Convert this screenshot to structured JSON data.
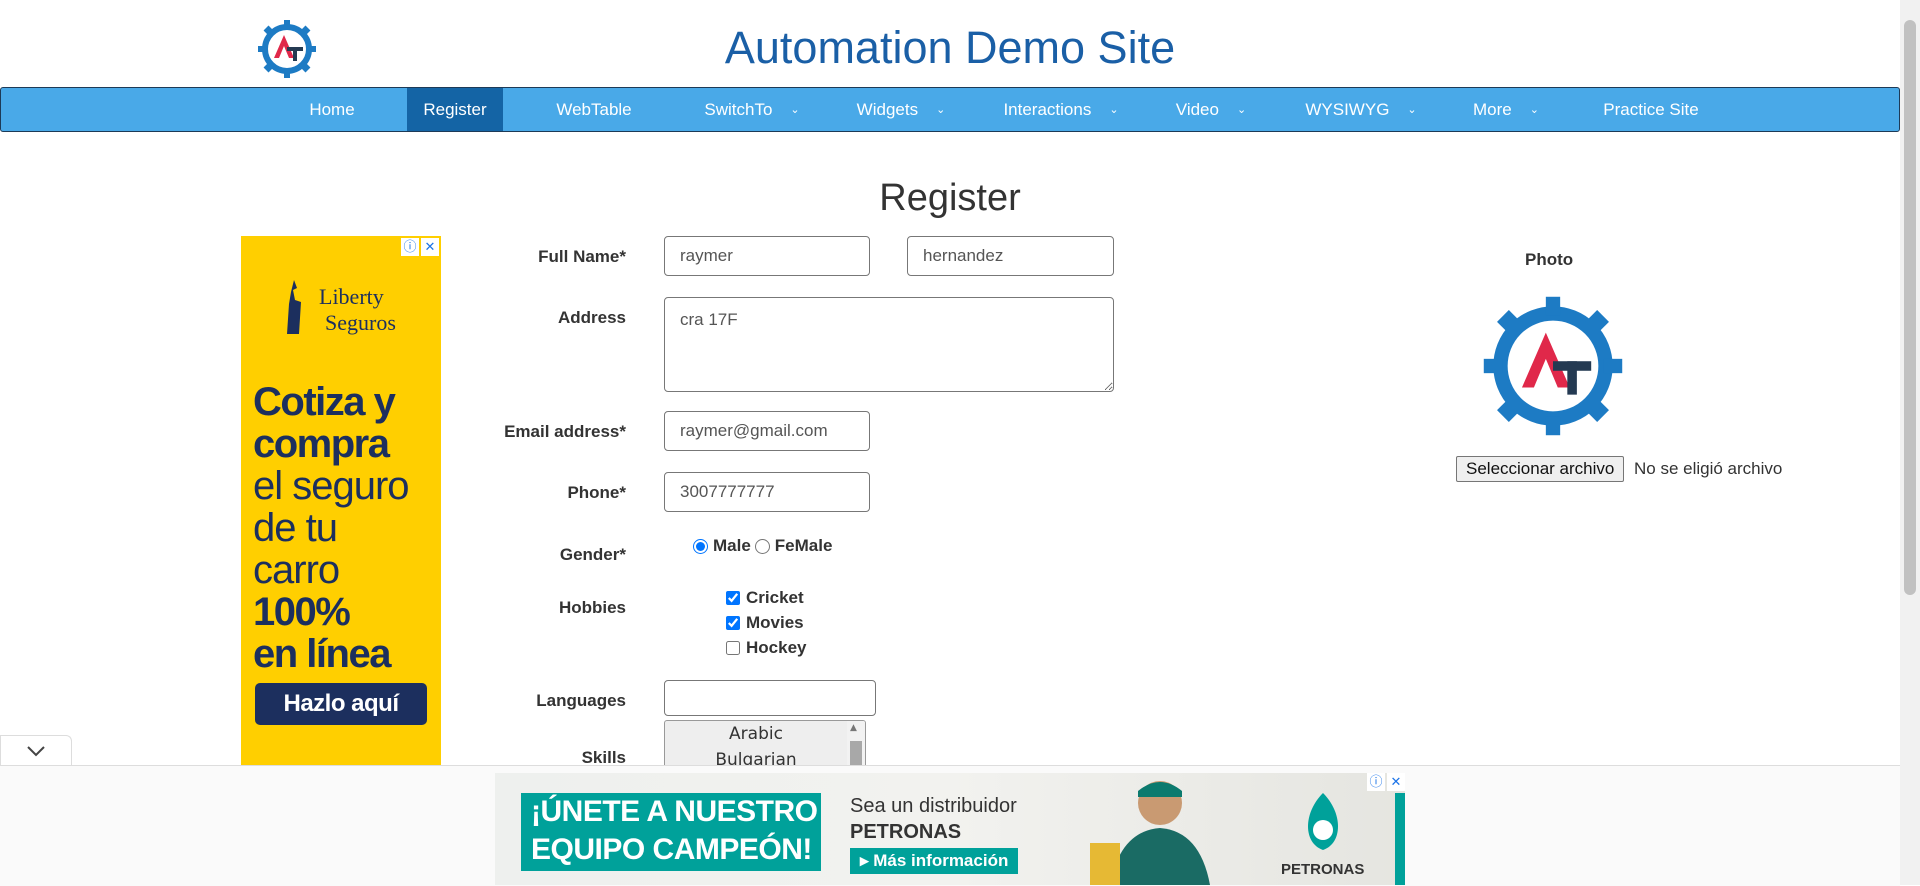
{
  "header": {
    "title": "Automation Demo Site"
  },
  "nav": {
    "items": [
      {
        "label": "Home"
      },
      {
        "label": "Register"
      },
      {
        "label": "WebTable"
      },
      {
        "label": "SwitchTo",
        "dropdown": true
      },
      {
        "label": "Widgets",
        "dropdown": true
      },
      {
        "label": "Interactions",
        "dropdown": true
      },
      {
        "label": "Video",
        "dropdown": true
      },
      {
        "label": "WYSIWYG",
        "dropdown": true
      },
      {
        "label": "More",
        "dropdown": true
      },
      {
        "label": "Practice Site"
      }
    ],
    "active": "Register"
  },
  "page": {
    "title": "Register"
  },
  "form": {
    "full_name_label": "Full Name*",
    "first_name": "raymer",
    "last_name": "hernandez",
    "address_label": "Address",
    "address": "cra 17F",
    "email_label": "Email address*",
    "email": "raymer@gmail.com",
    "phone_label": "Phone*",
    "phone": "3007777777",
    "gender_label": "Gender*",
    "gender_options": [
      "Male",
      "FeMale"
    ],
    "gender_selected": "Male",
    "hobbies_label": "Hobbies",
    "hobbies": [
      {
        "label": "Cricket",
        "checked": true
      },
      {
        "label": "Movies",
        "checked": true
      },
      {
        "label": "Hockey",
        "checked": false
      }
    ],
    "languages_label": "Languages",
    "languages_value": "",
    "skills_label": "Skills",
    "skills_options": [
      "Arabic",
      "Bulgarian"
    ]
  },
  "photo": {
    "label": "Photo",
    "button_label": "Seleccionar archivo",
    "status": "No se eligió archivo"
  },
  "ads": {
    "left": {
      "brand": "Liberty Seguros",
      "brand_line1": "Liberty",
      "brand_line2": "Seguros",
      "headline_1": "Cotiza y",
      "headline_2": "compra",
      "headline_3": "el seguro",
      "headline_4": "de tu carro",
      "headline_5": "100%",
      "headline_6": "en línea",
      "cta": "Hazlo aquí"
    },
    "bottom": {
      "headline_1": "¡ÚNETE A NUESTRO",
      "headline_2": "EQUIPO CAMPEÓN!",
      "sub_1": "Sea un distribuidor",
      "sub_2": "PETRONAS",
      "cta": "▸ Más información",
      "brand": "PETRONAS"
    },
    "adchoices_info": "ⓘ",
    "adchoices_close": "✕"
  },
  "colors": {
    "nav_bg": "#49a9e8",
    "nav_active": "#1464a5",
    "title": "#1a5fa6",
    "ad_yellow": "#ffcf00",
    "petronas_green": "#00a19a"
  }
}
